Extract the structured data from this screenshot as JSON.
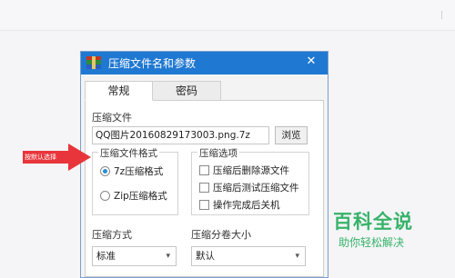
{
  "dialog": {
    "title": "压缩文件名和参数",
    "close_glyph": "✕",
    "tabs": [
      {
        "label": "常规",
        "active": true
      },
      {
        "label": "密码",
        "active": false
      }
    ],
    "file": {
      "label": "压缩文件",
      "value": "QQ图片20160829173003.png.7z",
      "browse_label": "浏览"
    },
    "format_group": {
      "title": "压缩文件格式",
      "options": [
        {
          "label": "7z压缩格式",
          "selected": true
        },
        {
          "label": "Zip压缩格式",
          "selected": false
        }
      ]
    },
    "options_group": {
      "title": "压缩选项",
      "items": [
        {
          "label": "压缩后删除源文件",
          "checked": false
        },
        {
          "label": "压缩后测试压缩文件",
          "checked": false
        },
        {
          "label": "操作完成后关机",
          "checked": false
        }
      ]
    },
    "method": {
      "label": "压缩方式",
      "value": "标准"
    },
    "split": {
      "label": "压缩分卷大小",
      "value": "默认"
    }
  },
  "annotation": {
    "text": "按默认选择"
  },
  "watermark": {
    "title": "百科全说",
    "subtitle": "助你轻松解决"
  },
  "colors": {
    "titlebar": "#1f78d1",
    "arrow": "#e8353b",
    "watermark": "#37b36a",
    "radio_accent": "#2a8dd8"
  },
  "icons": {
    "app": "winrar-archive-icon",
    "close": "close-icon",
    "dropdown": "chevron-down-icon"
  }
}
